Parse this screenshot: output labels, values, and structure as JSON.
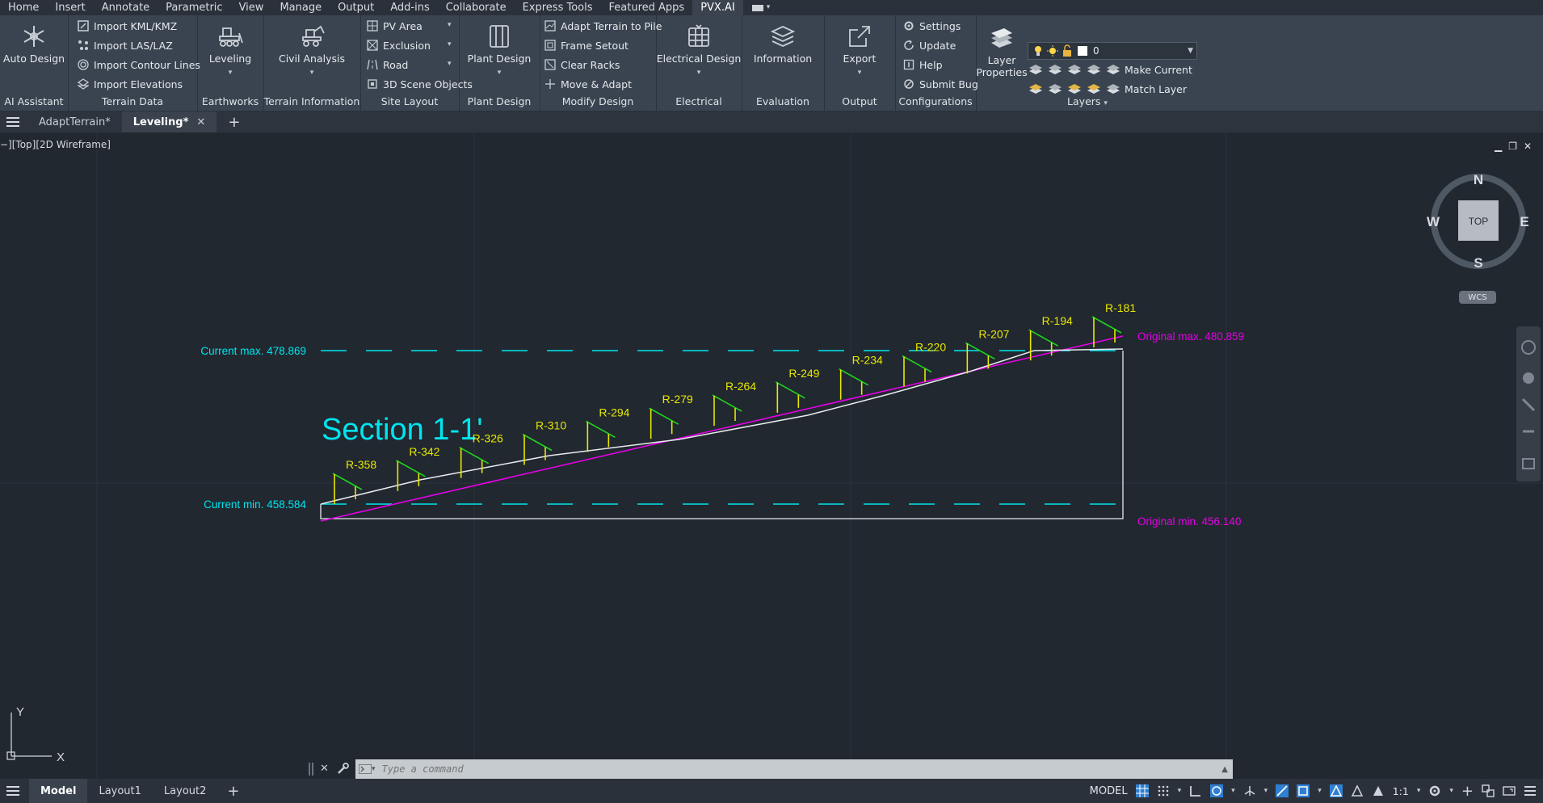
{
  "menu": [
    "Home",
    "Insert",
    "Annotate",
    "Parametric",
    "View",
    "Manage",
    "Output",
    "Add-ins",
    "Collaborate",
    "Express Tools",
    "Featured Apps",
    "PVX.AI"
  ],
  "ribbon": {
    "ai_assistant": {
      "button": "Auto Design",
      "title": "AI Assistant"
    },
    "terrain_data": {
      "items": [
        "Import KML/KMZ",
        "Import LAS/LAZ",
        "Import Contour Lines",
        "Import Elevations"
      ],
      "title": "Terrain Data"
    },
    "earthworks": {
      "button": "Leveling",
      "title": "Earthworks"
    },
    "terrain_information": {
      "button": "Civil Analysis",
      "title": "Terrain Information"
    },
    "site_layout": {
      "items": [
        "PV Area",
        "Exclusion",
        "Road",
        "3D Scene Objects"
      ],
      "title": "Site Layout"
    },
    "plant_design": {
      "button": "Plant Design",
      "title": "Plant Design"
    },
    "modify_design": {
      "items": [
        "Adapt Terrain to Pile",
        "Frame Setout",
        "Clear Racks",
        "Move & Adapt"
      ],
      "title": "Modify Design"
    },
    "electrical": {
      "button": "Electrical Design",
      "title": "Electrical"
    },
    "evaluation": {
      "button": "Information",
      "title": "Evaluation"
    },
    "output": {
      "button": "Export",
      "title": "Output"
    },
    "configurations": {
      "items": [
        "Settings",
        "Update",
        "Help",
        "Submit Bug"
      ],
      "title": "Configurations"
    },
    "layers": {
      "button_line1": "Layer",
      "button_line2": "Properties",
      "current_layer": "0",
      "make_current": "Make Current",
      "match_layer": "Match Layer",
      "title": "Layers"
    }
  },
  "tabs": {
    "items": [
      "AdaptTerrain*",
      "Leveling*"
    ],
    "active": "Leveling*"
  },
  "viewport": {
    "label": "−][Top][2D Wireframe]"
  },
  "viewcube": {
    "n": "N",
    "s": "S",
    "e": "E",
    "w": "W",
    "face": "TOP",
    "wcs": "WCS"
  },
  "ucs": {
    "x": "X",
    "y": "Y"
  },
  "drawing": {
    "title": "Section 1-1'",
    "current_max": "Current max. 478.869",
    "current_min": "Current min. 458.584",
    "original_max": "Original max. 480.859",
    "original_min": "Original min. 456.140",
    "rows": [
      "R-358",
      "R-342",
      "R-326",
      "R-310",
      "R-294",
      "R-279",
      "R-264",
      "R-249",
      "R-234",
      "R-220",
      "R-207",
      "R-194",
      "R-181"
    ]
  },
  "command": {
    "placeholder": "Type a command"
  },
  "status": {
    "layouts": [
      "Model",
      "Layout1",
      "Layout2"
    ],
    "model_label": "MODEL",
    "scale": "1:1"
  },
  "colors": {
    "cyan": "#00e5ee",
    "magenta": "#e600e6",
    "yellow": "#e8e800",
    "green": "#1ed41e",
    "accent": "#2f7fd1"
  }
}
